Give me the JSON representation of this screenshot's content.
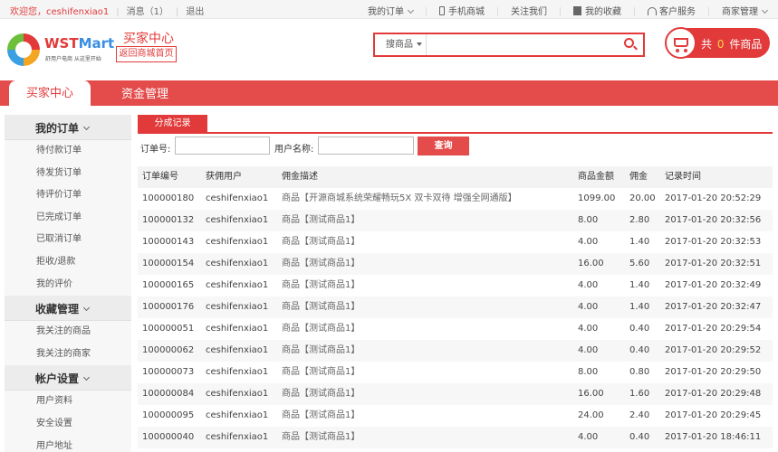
{
  "topbar": {
    "welcome": "欢迎您，ceshifenxiao1",
    "messages": "消息（1）",
    "logout": "退出",
    "links": [
      "我的订单",
      "手机商城",
      "关注我们",
      "我的收藏",
      "客户服务",
      "商家管理"
    ]
  },
  "header": {
    "logo_wst": "WST",
    "logo_mart": "Mart",
    "logo_slogan": "舒用户电商 从这里开始",
    "buyer_center": "买家中心",
    "back_home": "返回商城首页",
    "search_type": "搜商品",
    "search_placeholder": "",
    "cart_prefix": "共",
    "cart_count": "0",
    "cart_suffix": "件商品"
  },
  "nav": {
    "active_tab": "买家中心",
    "tab2": "资金管理"
  },
  "sidebar": {
    "groups": [
      {
        "title": "我的订单",
        "items": [
          "待付款订单",
          "待发货订单",
          "待评价订单",
          "已完成订单",
          "已取消订单",
          "拒收/退款",
          "我的评价"
        ]
      },
      {
        "title": "收藏管理",
        "items": [
          "我关注的商品",
          "我关注的商家"
        ]
      },
      {
        "title": "帐户设置",
        "items": [
          "用户资料",
          "安全设置",
          "用户地址"
        ]
      }
    ]
  },
  "main": {
    "tab": "分成记录",
    "filter": {
      "order_label": "订单号:",
      "order_value": "",
      "user_label": "用户名称:",
      "user_value": "",
      "query_button": "查询"
    },
    "columns": [
      "订单编号",
      "获佣用户",
      "佣金描述",
      "商品金额",
      "佣金",
      "记录时间"
    ],
    "rows": [
      [
        "100000180",
        "ceshifenxiao1",
        "商品【开源商城系统荣耀畅玩5X 双卡双待 增强全网通版】",
        "1099.00",
        "20.00",
        "2017-01-20 20:52:29"
      ],
      [
        "100000132",
        "ceshifenxiao1",
        "商品【测试商品1】",
        "8.00",
        "2.80",
        "2017-01-20 20:32:56"
      ],
      [
        "100000143",
        "ceshifenxiao1",
        "商品【测试商品1】",
        "4.00",
        "1.40",
        "2017-01-20 20:32:53"
      ],
      [
        "100000154",
        "ceshifenxiao1",
        "商品【测试商品1】",
        "16.00",
        "5.60",
        "2017-01-20 20:32:51"
      ],
      [
        "100000165",
        "ceshifenxiao1",
        "商品【测试商品1】",
        "4.00",
        "1.40",
        "2017-01-20 20:32:49"
      ],
      [
        "100000176",
        "ceshifenxiao1",
        "商品【测试商品1】",
        "4.00",
        "1.40",
        "2017-01-20 20:32:47"
      ],
      [
        "100000051",
        "ceshifenxiao1",
        "商品【测试商品1】",
        "4.00",
        "0.40",
        "2017-01-20 20:29:54"
      ],
      [
        "100000062",
        "ceshifenxiao1",
        "商品【测试商品1】",
        "4.00",
        "0.40",
        "2017-01-20 20:29:52"
      ],
      [
        "100000073",
        "ceshifenxiao1",
        "商品【测试商品1】",
        "8.00",
        "0.80",
        "2017-01-20 20:29:50"
      ],
      [
        "100000084",
        "ceshifenxiao1",
        "商品【测试商品1】",
        "16.00",
        "1.60",
        "2017-01-20 20:29:48"
      ],
      [
        "100000095",
        "ceshifenxiao1",
        "商品【测试商品1】",
        "24.00",
        "2.40",
        "2017-01-20 20:29:45"
      ],
      [
        "100000040",
        "ceshifenxiao1",
        "商品【测试商品1】",
        "4.00",
        "0.40",
        "2017-01-20 18:46:11"
      ]
    ]
  },
  "colors": {
    "accent": "#e23a3a",
    "nav_bg": "#e44b4b"
  }
}
